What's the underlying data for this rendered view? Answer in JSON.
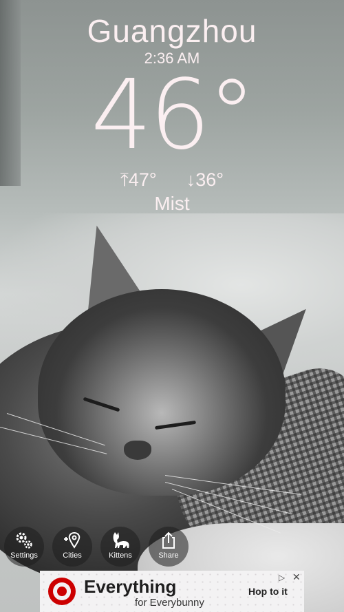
{
  "weather": {
    "city": "Guangzhou",
    "time": "2:36 AM",
    "temperature": "46°",
    "high": "47°",
    "low": "36°",
    "condition": "Mist"
  },
  "nav": {
    "settings": "Settings",
    "cities": "Cities",
    "kittens": "Kittens",
    "share": "Share"
  },
  "ad": {
    "headline": "Everything",
    "subline": "for Everybunny",
    "cta": "Hop to it"
  },
  "icons": {
    "settings": "gears-icon",
    "cities": "location-pin-plus-icon",
    "kittens": "cat-silhouette-icon",
    "share": "share-icon",
    "high": "arrow-up-icon",
    "low": "arrow-down-icon",
    "ad_logo": "target-bullseye-logo"
  },
  "colors": {
    "text": "#fbeff1",
    "nav_bg": "#1e1e1e",
    "ad_logo": "#cc0000"
  }
}
